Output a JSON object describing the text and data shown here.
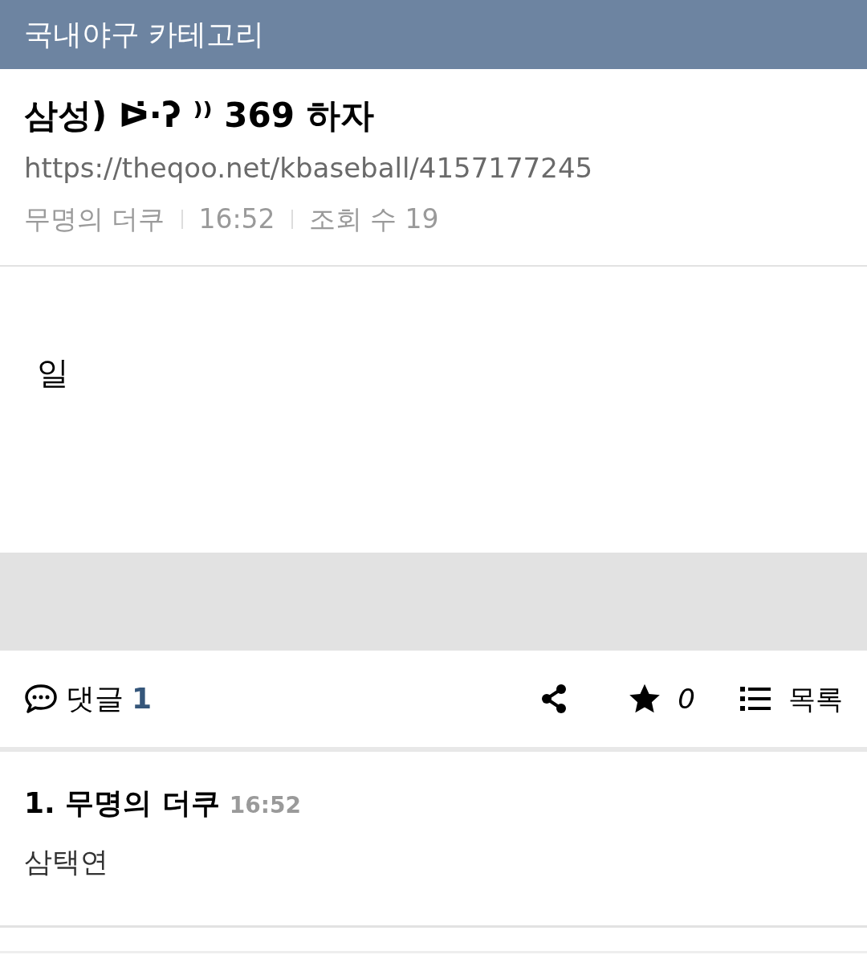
{
  "header": {
    "title": "국내야구 카테고리"
  },
  "post": {
    "title": "삼성) ᐅ̇·ʔ ⁾⁾ 369 하자",
    "url": "https://theqoo.net/kbaseball/4157177245",
    "author": "무명의 더쿠",
    "time": "16:52",
    "views": "조회 수 19",
    "body": "일"
  },
  "actions": {
    "comments_label": "댓글",
    "comments_count": "1",
    "stars_count": "0",
    "list_label": "목록"
  },
  "comments": [
    {
      "number": "1.",
      "author": "무명의 더쿠",
      "time": "16:52",
      "text": "삼택연"
    }
  ]
}
